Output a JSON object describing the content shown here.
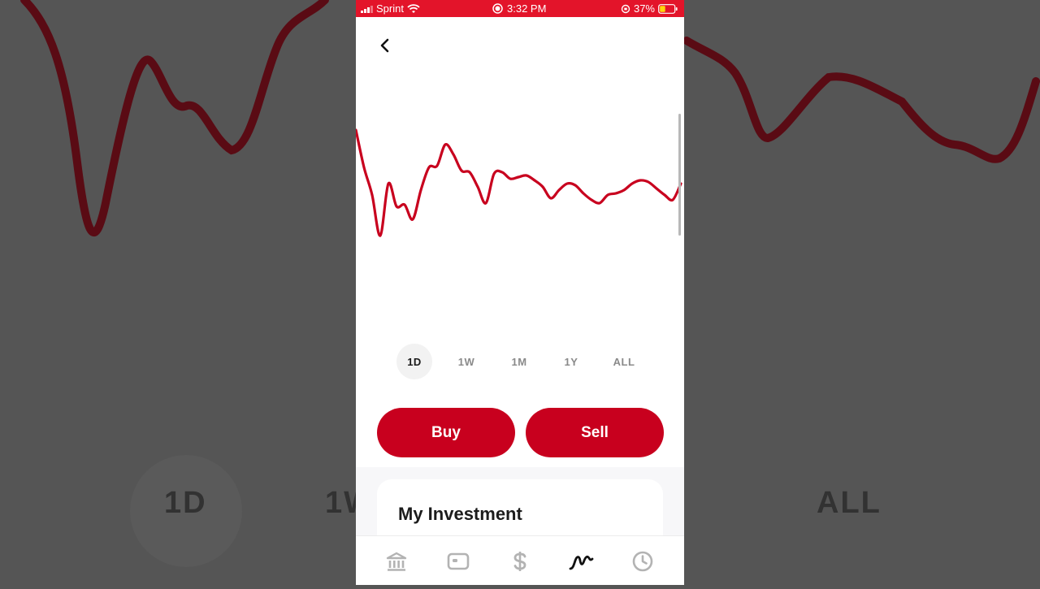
{
  "status_bar": {
    "carrier": "Sprint",
    "time": "3:32 PM",
    "battery": "37%"
  },
  "timeframes": [
    {
      "label": "1D",
      "active": true
    },
    {
      "label": "1W",
      "active": false
    },
    {
      "label": "1M",
      "active": false
    },
    {
      "label": "1Y",
      "active": false
    },
    {
      "label": "ALL",
      "active": false
    }
  ],
  "actions": {
    "buy_label": "Buy",
    "sell_label": "Sell"
  },
  "investment_card": {
    "title": "My Investment"
  },
  "tabs": [
    {
      "name": "banking-icon",
      "active": false
    },
    {
      "name": "card-icon",
      "active": false
    },
    {
      "name": "dollar-icon",
      "active": false
    },
    {
      "name": "investing-icon",
      "active": true
    },
    {
      "name": "activity-icon",
      "active": false
    }
  ],
  "colors": {
    "accent": "#c8001e",
    "status_bar": "#e3142a",
    "line": "#c8001e"
  },
  "chart_data": {
    "type": "line",
    "title": "",
    "xlabel": "",
    "ylabel": "",
    "grid": false,
    "ylim": [
      0,
      100
    ],
    "x": [
      0,
      1,
      2,
      3,
      4,
      5,
      6,
      7,
      8,
      9,
      10,
      11,
      12,
      13,
      14,
      15,
      16,
      17,
      18,
      19,
      20,
      21,
      22,
      23,
      24,
      25,
      26,
      27,
      28,
      29,
      30,
      31,
      32,
      33,
      34,
      35,
      36,
      37,
      38,
      39,
      40
    ],
    "series": [
      {
        "values": [
          95,
          72,
          55,
          30,
          62,
          48,
          49,
          40,
          58,
          72,
          73,
          86,
          80,
          70,
          69,
          60,
          50,
          68,
          69,
          65,
          66,
          67,
          64,
          60,
          53,
          58,
          62,
          61,
          56,
          52,
          50,
          55,
          56,
          58,
          62,
          64,
          63,
          59,
          55,
          52,
          62
        ]
      }
    ]
  }
}
